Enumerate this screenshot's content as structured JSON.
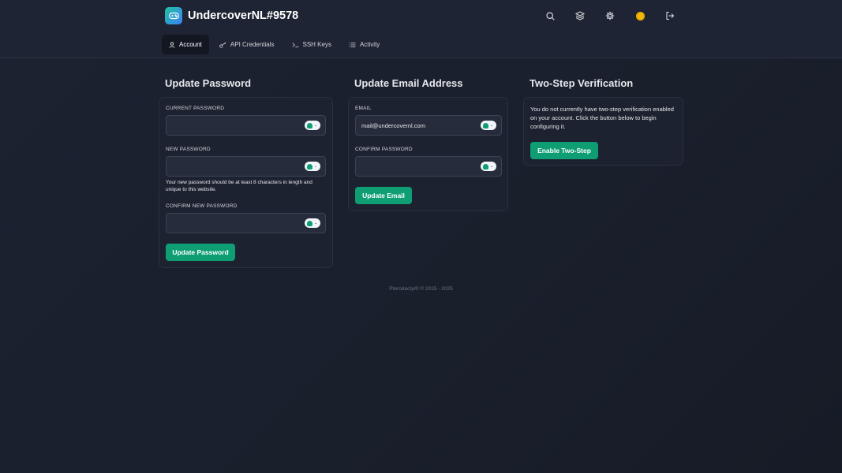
{
  "header": {
    "title": "UndercoverNL#9578",
    "icons": [
      "search-icon",
      "layers-icon",
      "gear-icon",
      "coin-icon",
      "logout-icon"
    ]
  },
  "tabs": [
    {
      "label": "Account",
      "icon": "user-icon",
      "active": true
    },
    {
      "label": "API Credentials",
      "icon": "key-icon",
      "active": false
    },
    {
      "label": "SSH Keys",
      "icon": "terminal-icon",
      "active": false
    },
    {
      "label": "Activity",
      "icon": "list-icon",
      "active": false
    }
  ],
  "password": {
    "title": "Update Password",
    "current_label": "CURRENT PASSWORD",
    "current_value": "",
    "new_label": "NEW PASSWORD",
    "new_value": "",
    "new_help": "Your new password should be at least 8 characters in length and unique to this website.",
    "confirm_label": "CONFIRM NEW PASSWORD",
    "confirm_value": "",
    "button": "Update Password"
  },
  "email": {
    "title": "Update Email Address",
    "email_label": "EMAIL",
    "email_value": "mail@undercovernl.com",
    "confirm_label": "CONFIRM PASSWORD",
    "confirm_value": "",
    "button": "Update Email"
  },
  "twostep": {
    "title": "Two-Step Verification",
    "text": "You do not currently have two-step verification enabled on your account. Click the button below to begin configuring it.",
    "button": "Enable Two-Step"
  },
  "footer": "Pterodactyl® © 2015 - 2025",
  "colors": {
    "accent": "#0f9d74",
    "coin": "#f5b800"
  }
}
